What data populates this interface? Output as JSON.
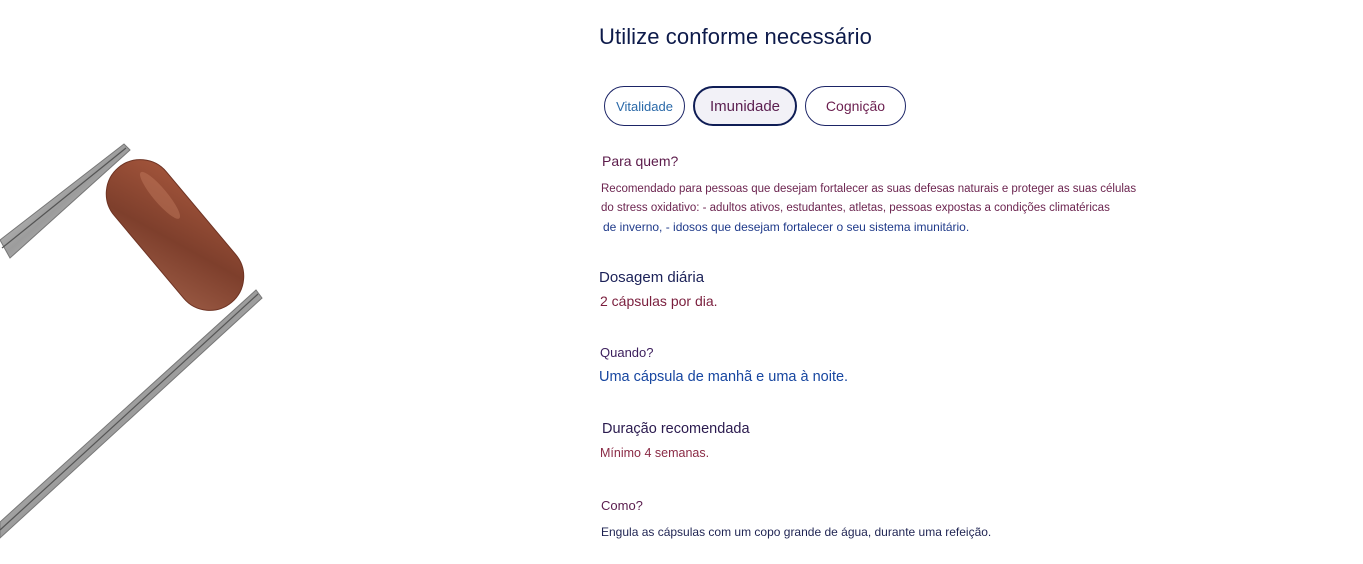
{
  "header": {
    "title": "Utilize conforme necessário"
  },
  "tabs": [
    {
      "label": "Vitalidade",
      "selected": false
    },
    {
      "label": "Imunidade",
      "selected": true
    },
    {
      "label": "Cognição",
      "selected": false
    }
  ],
  "details": {
    "para_quem_label": "Para quem?",
    "para_quem_line1": "Recomendado para pessoas que desejam fortalecer as suas defesas naturais e proteger as suas células",
    "para_quem_line2": "do stress oxidativo: - adultos ativos, estudantes, atletas, pessoas expostas a condições climatéricas",
    "para_quem_line3": "de inverno, - idosos que desejam fortalecer o seu sistema imunitário.",
    "dosagem_label": "Dosagem diária",
    "dosagem_value": "2 cápsulas por dia.",
    "quando_label": "Quando?",
    "quando_value": "Uma cápsula de manhã e uma à noite.",
    "duracao_label": "Duração recomendada",
    "duracao_value": "Mínimo 4 semanas.",
    "como_label": "Como?",
    "como_value": "Engula as cápsulas com um copo grande de água, durante uma refeição."
  },
  "image": {
    "icon": "capsule-in-tweezers-illustration"
  },
  "colors": {
    "navy": "#0d1a4a",
    "plum": "#6c2550",
    "blue": "#1746a0",
    "capsule": "#8b4a36"
  }
}
